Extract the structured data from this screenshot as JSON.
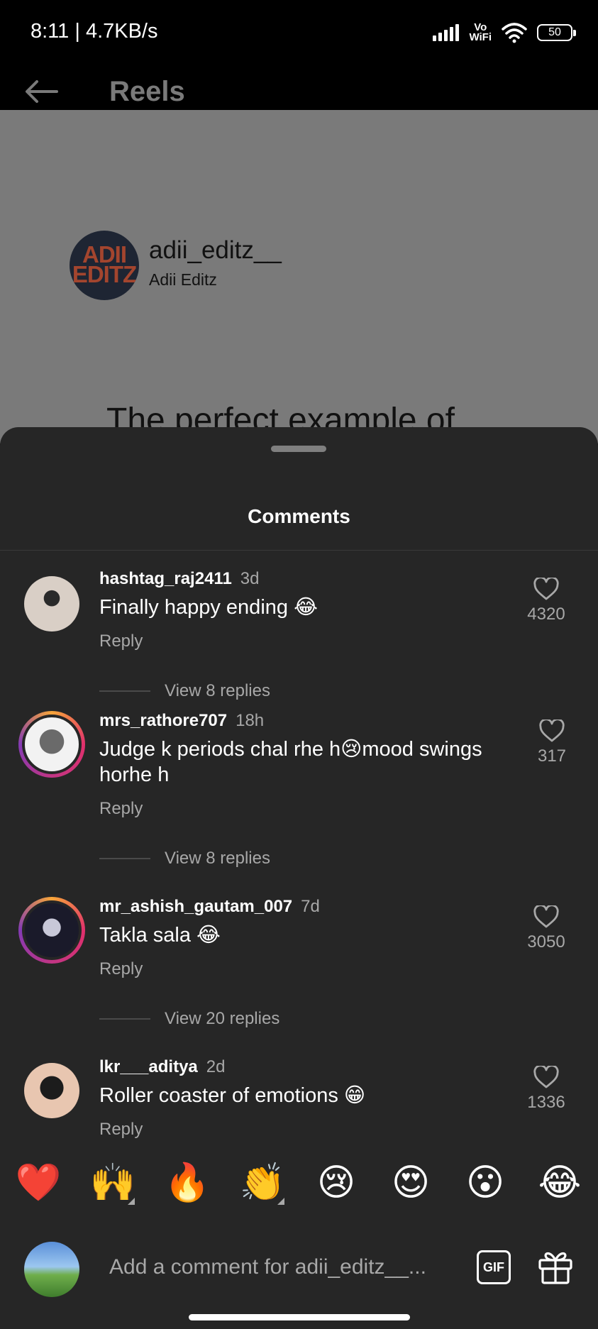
{
  "status_bar": {
    "time": "8:11 | 4.7KB/s",
    "network_label": "Vo\nWiFi",
    "battery": "50"
  },
  "header": {
    "title": "Reels"
  },
  "reel": {
    "creator_handle": "adii_editz__",
    "creator_name": "Adii Editz",
    "avatar_logo_text": "ADII\nEDITZ",
    "caption_visible": "The perfect example of"
  },
  "comments_sheet": {
    "title": "Comments",
    "reply_label": "Reply",
    "comments": [
      {
        "username": "hashtag_raj2411",
        "time": "3d",
        "text": "Finally happy ending 😂",
        "likes": "4320",
        "view_replies": "View 8 replies",
        "story_ring": false
      },
      {
        "username": "mrs_rathore707",
        "time": "18h",
        "text": "Judge k periods chal rhe h😢mood swings horhe h",
        "likes": "317",
        "view_replies": "View 8 replies",
        "story_ring": true
      },
      {
        "username": "mr_ashish_gautam_007",
        "time": "7d",
        "text": "Takla sala 😂",
        "likes": "3050",
        "view_replies": "View 20 replies",
        "story_ring": true
      },
      {
        "username": "lkr___aditya",
        "time": "2d",
        "text": "Roller coaster of emotions 😁",
        "likes": "1336",
        "view_replies": "",
        "story_ring": false
      }
    ]
  },
  "emoji_bar": {
    "emojis": [
      "❤️",
      "🙌",
      "🔥",
      "👏",
      "😢",
      "😍",
      "😮",
      "😂"
    ]
  },
  "comment_input": {
    "placeholder": "Add a comment for adii_editz__...",
    "gif_label": "GIF"
  },
  "colors": {
    "sheet_bg": "#262626",
    "secondary_text": "#a8a8a8",
    "dim_overlay": "#7a7a7a"
  }
}
